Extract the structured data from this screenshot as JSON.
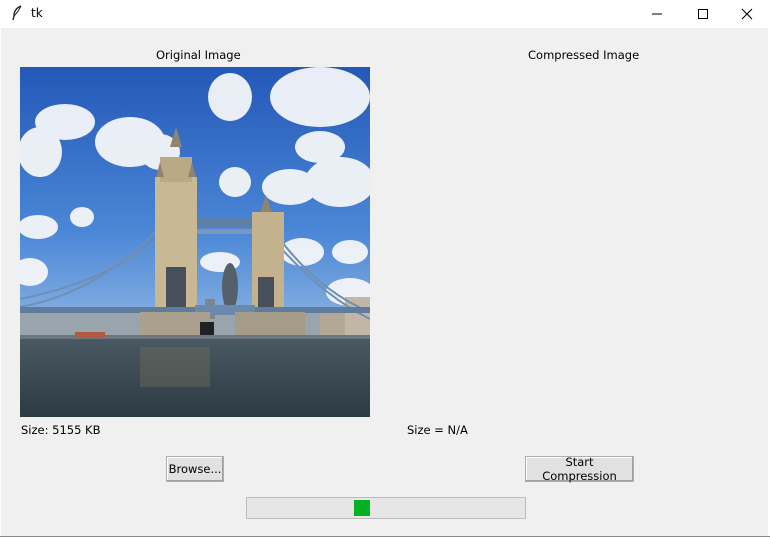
{
  "window": {
    "title": "tk"
  },
  "left_panel": {
    "heading": "Original Image",
    "size_text": "Size: 5155 KB"
  },
  "right_panel": {
    "heading": "Compressed Image",
    "size_text": "Size = N/A"
  },
  "buttons": {
    "browse_label": "Browse...",
    "start_label": "Start Compression"
  },
  "progress": {
    "mode": "indeterminate",
    "color": "#06b025"
  },
  "colors": {
    "window_bg": "#f0f0f0",
    "button_bg": "#e1e1e1"
  }
}
